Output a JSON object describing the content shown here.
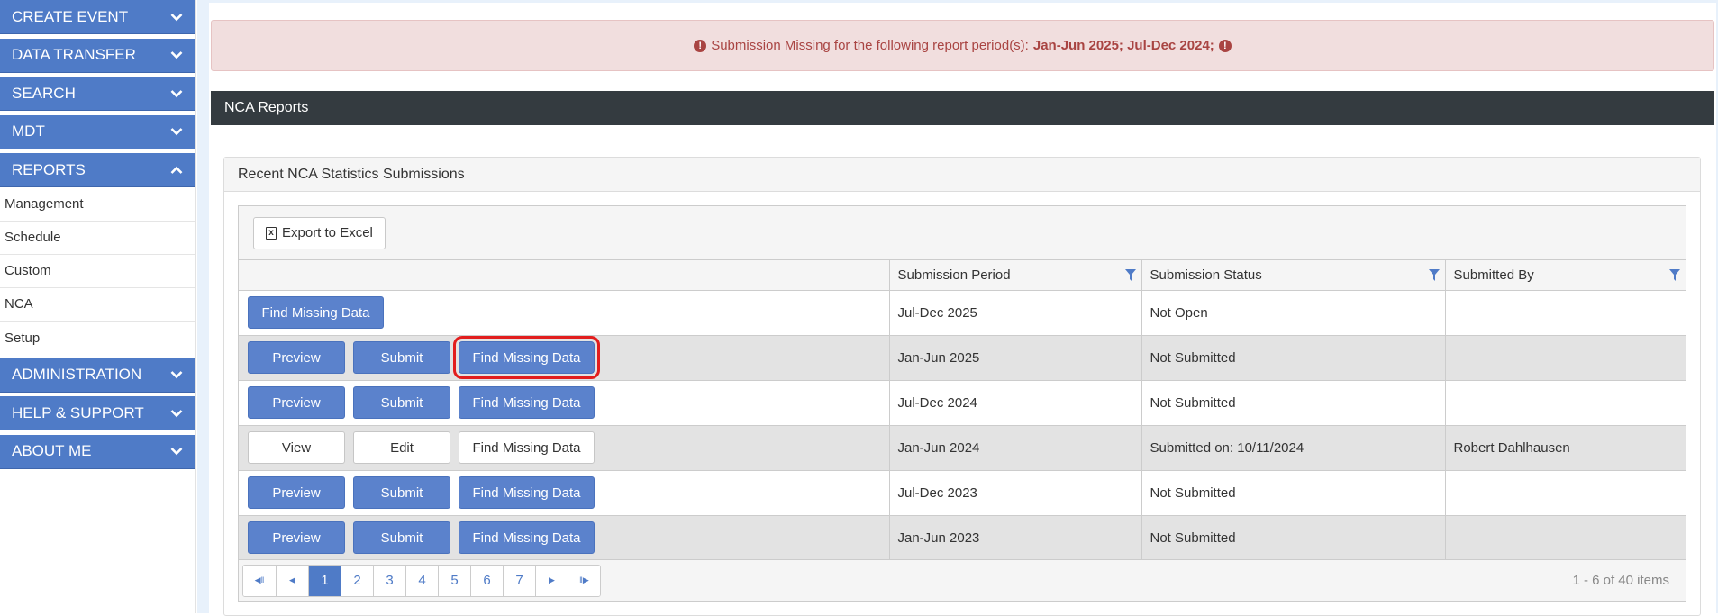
{
  "sidebar": {
    "sections": [
      {
        "label": "CREATE EVENT",
        "expanded": false
      },
      {
        "label": "DATA TRANSFER",
        "expanded": false
      },
      {
        "label": "SEARCH",
        "expanded": false
      },
      {
        "label": "MDT",
        "expanded": false
      },
      {
        "label": "REPORTS",
        "expanded": true
      }
    ],
    "report_items": [
      "Management",
      "Schedule",
      "Custom",
      "NCA",
      "Setup"
    ],
    "lower_sections": [
      {
        "label": "ADMINISTRATION"
      },
      {
        "label": "HELP & SUPPORT"
      },
      {
        "label": "ABOUT ME"
      }
    ]
  },
  "alert": {
    "prefix": "Submission Missing for the following report period(s):",
    "periods": "Jan-Jun 2025; Jul-Dec 2024;"
  },
  "panel": {
    "title": "NCA Reports",
    "subpanel_title": "Recent NCA Statistics Submissions"
  },
  "toolbar": {
    "export_label": "Export to Excel"
  },
  "table": {
    "columns": [
      "",
      "Submission Period",
      "Submission Status",
      "Submitted By"
    ],
    "rows": [
      {
        "actions": [
          "Find Missing Data"
        ],
        "period": "Jul-Dec 2025",
        "status": "Not Open",
        "by": ""
      },
      {
        "actions": [
          "Preview",
          "Submit",
          "Find Missing Data"
        ],
        "period": "Jan-Jun 2025",
        "status": "Not Submitted",
        "by": ""
      },
      {
        "actions": [
          "Preview",
          "Submit",
          "Find Missing Data"
        ],
        "period": "Jul-Dec 2024",
        "status": "Not Submitted",
        "by": ""
      },
      {
        "actions": [
          "View",
          "Edit",
          "Find Missing Data"
        ],
        "period": "Jan-Jun 2024",
        "status": "Submitted on: 10/11/2024",
        "by": "Robert Dahlhausen"
      },
      {
        "actions": [
          "Preview",
          "Submit",
          "Find Missing Data"
        ],
        "period": "Jul-Dec 2023",
        "status": "Not Submitted",
        "by": ""
      },
      {
        "actions": [
          "Preview",
          "Submit",
          "Find Missing Data"
        ],
        "period": "Jan-Jun 2023",
        "status": "Not Submitted",
        "by": ""
      }
    ]
  },
  "pager": {
    "pages": [
      "1",
      "2",
      "3",
      "4",
      "5",
      "6",
      "7"
    ],
    "current": "1",
    "info": "1 - 6 of 40 items"
  },
  "colors": {
    "nav_blue": "#4f7bc7",
    "button_blue": "#5b82cc",
    "alert_text": "#a94442",
    "panel_dark": "#343b40",
    "highlight_red": "#e21d1d"
  }
}
